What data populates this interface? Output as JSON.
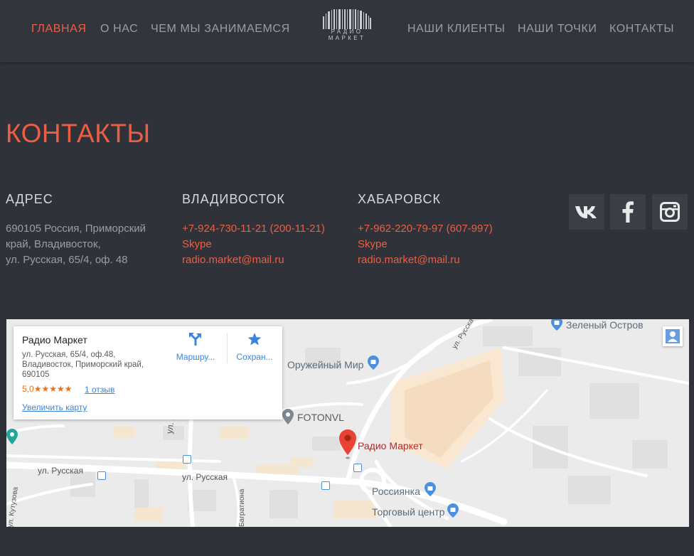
{
  "nav": {
    "left": [
      "ГЛАВНАЯ",
      "О НАС",
      "ЧЕМ МЫ ЗАНИМАЕМСЯ"
    ],
    "right": [
      "НАШИ КЛИЕНТЫ",
      "НАШИ ТОЧКИ",
      "КОНТАКТЫ"
    ],
    "active": "ГЛАВНАЯ",
    "logo_line1": "РАДИО",
    "logo_line2": "МАРКЕТ"
  },
  "contacts": {
    "title": "КОНТАКТЫ",
    "address": {
      "heading": "АДРЕС",
      "lines": [
        "690105 Россия, Приморский",
        "край, Владивосток,",
        "ул. Русская, 65/4, оф. 48"
      ]
    },
    "vladivostok": {
      "heading": "ВЛАДИВОСТОК",
      "phone": "+7-924-730-11-21 (200-11-21)",
      "skype": "Skype",
      "email": "radio.market@mail.ru"
    },
    "khabarovsk": {
      "heading": "ХАБАРОВСК",
      "phone": "+7-962-220-79-97 (607-997)",
      "skype": "Skype",
      "email": "radio.market@mail.ru"
    },
    "social": [
      "vk-icon",
      "facebook-icon",
      "instagram-icon"
    ]
  },
  "map": {
    "card": {
      "name": "Радио Маркет",
      "address": "ул. Русская, 65/4, оф.48, Владивосток, Приморский край, 690105",
      "rating": "5,0",
      "stars": "★★★★★",
      "reviews": "1 отзыв",
      "enlarge": "Увеличить карту",
      "route": "Маршру...",
      "save": "Сохран..."
    },
    "labels": {
      "green_island": "Зеленый Остров",
      "gun_world": "Оружейный Мир",
      "fotonvl": "FOTONVL",
      "marker": "Радио Маркет",
      "rossiyanka": "Россиянка",
      "mall": "Торговый центр"
    },
    "streets": {
      "russkaya1": "ул. Русская",
      "russkaya2": "ул. Русская",
      "russkaya_vert": "ул. Русская",
      "russkaya_top": "ул. Русска",
      "kutuzova": "ул. Кутузова",
      "bagrationa": "Багратиона"
    },
    "colors": {
      "marker": "#ea4335",
      "accent": "#ef5d43"
    }
  }
}
